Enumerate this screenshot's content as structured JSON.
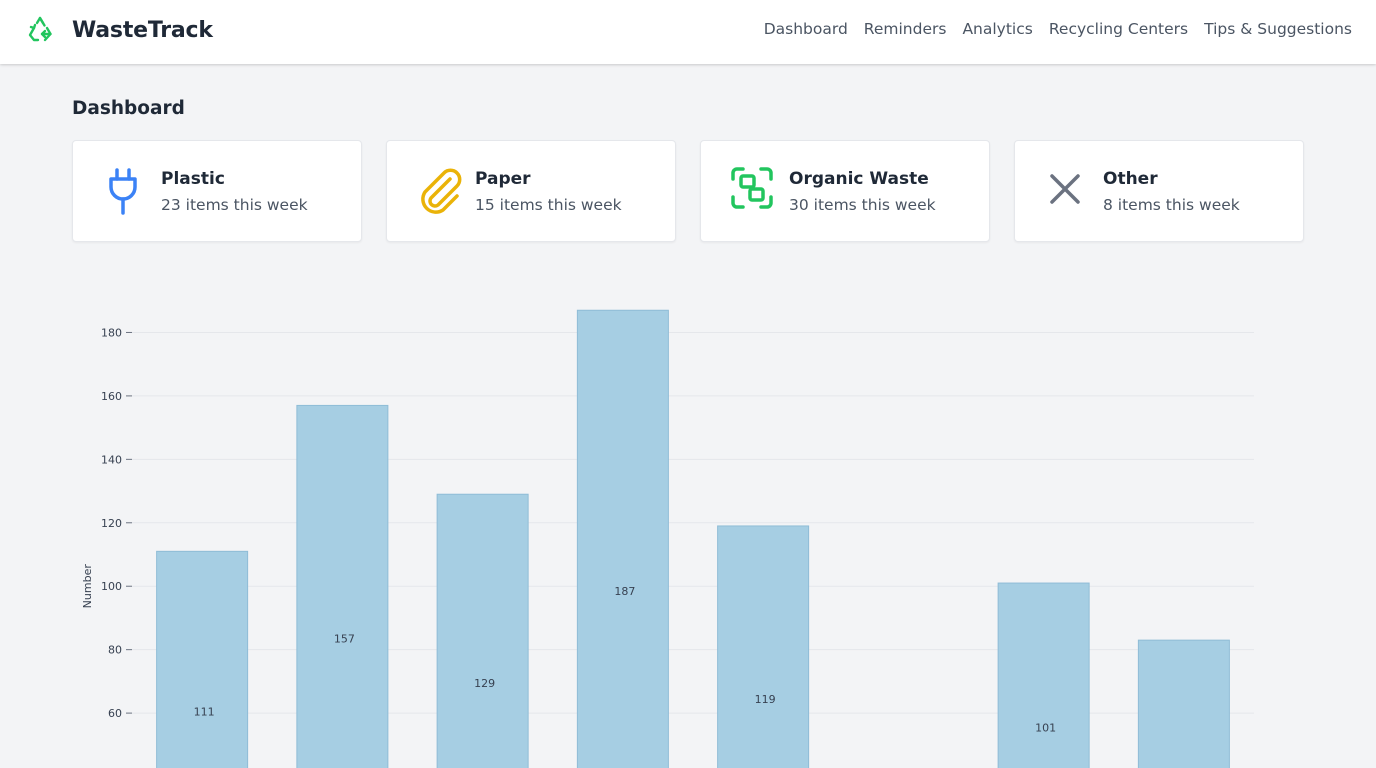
{
  "app": {
    "name": "WasteTrack",
    "logo_icon": "recycle-icon",
    "accent": "#22c55e"
  },
  "nav": [
    {
      "label": "Dashboard"
    },
    {
      "label": "Reminders"
    },
    {
      "label": "Analytics"
    },
    {
      "label": "Recycling Centers"
    },
    {
      "label": "Tips & Suggestions"
    }
  ],
  "page": {
    "title": "Dashboard"
  },
  "cards": [
    {
      "title": "Plastic",
      "sub": "23 items this week",
      "icon": "plug-icon",
      "color": "#3b82f6"
    },
    {
      "title": "Paper",
      "sub": "15 items this week",
      "icon": "paperclip-icon",
      "color": "#eab308"
    },
    {
      "title": "Organic Waste",
      "sub": "30 items this week",
      "icon": "scan-icon",
      "color": "#22c55e"
    },
    {
      "title": "Other",
      "sub": "8 items this week",
      "icon": "close-icon",
      "color": "#6b7280"
    }
  ],
  "chart_data": {
    "type": "bar",
    "ylabel": "Number",
    "xlabel": "",
    "ylim": [
      50,
      186
    ],
    "yticks": [
      60,
      80,
      100,
      120,
      140,
      160,
      180
    ],
    "grid": true,
    "bar_color": "#a6cee3",
    "values": [
      111,
      157,
      129,
      187,
      119,
      null,
      101,
      83
    ],
    "data_labels": [
      "111",
      "157",
      "129",
      "187",
      "119",
      "",
      "101",
      ""
    ]
  }
}
